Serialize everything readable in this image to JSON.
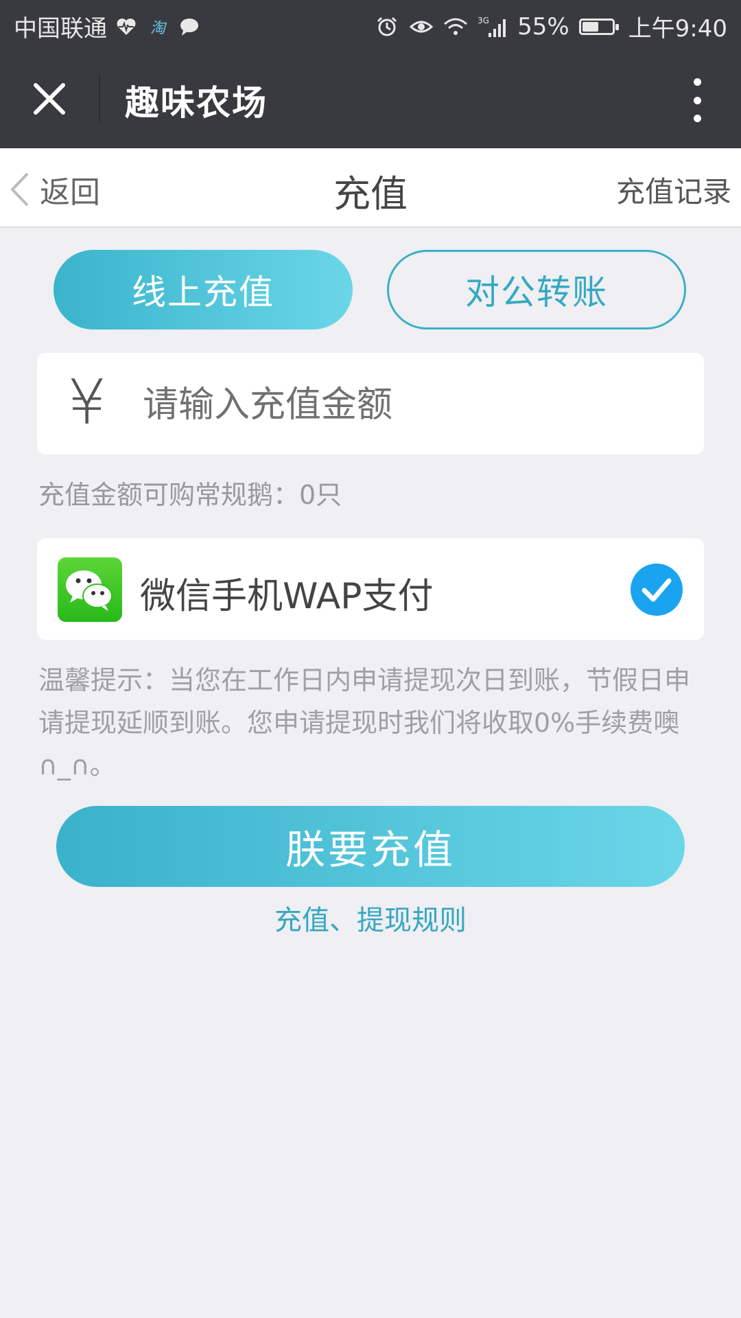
{
  "status_bar": {
    "carrier": "中国联通",
    "notification_icons": [
      "heart-pulse-icon",
      "taobao-icon",
      "chat-bubble-icon"
    ],
    "taobao_char": "淘",
    "network": "3G",
    "battery_percent": "55%",
    "battery_level": 0.55,
    "time": "上午9:40"
  },
  "wechat_bar": {
    "title": "趣味农场"
  },
  "page_nav": {
    "back_label": "返回",
    "title": "充值",
    "right_link": "充值记录"
  },
  "tabs": [
    {
      "label": "线上充值",
      "active": true
    },
    {
      "label": "对公转账",
      "active": false
    }
  ],
  "amount": {
    "currency_symbol": "¥",
    "placeholder": "请输入充值金额",
    "value": ""
  },
  "geese_hint": "充值金额可购常规鹅：0只",
  "payment": {
    "method_label": "微信手机WAP支付",
    "selected": true
  },
  "notice": "温馨提示：当您在工作日内申请提现次日到账，节假日申请提现延顺到账。您申请提现时我们将收取0%手续费噢 ∩_∩。",
  "submit_label": "朕要充值",
  "rules_link": "充值、提现规则",
  "colors": {
    "topbar": "#393a3f",
    "accent": "#3ab2cb",
    "accent_light": "#6bd6e8",
    "background": "#efeff4",
    "wechat_green": "#29b91a",
    "check_blue": "#1aa4f0"
  }
}
